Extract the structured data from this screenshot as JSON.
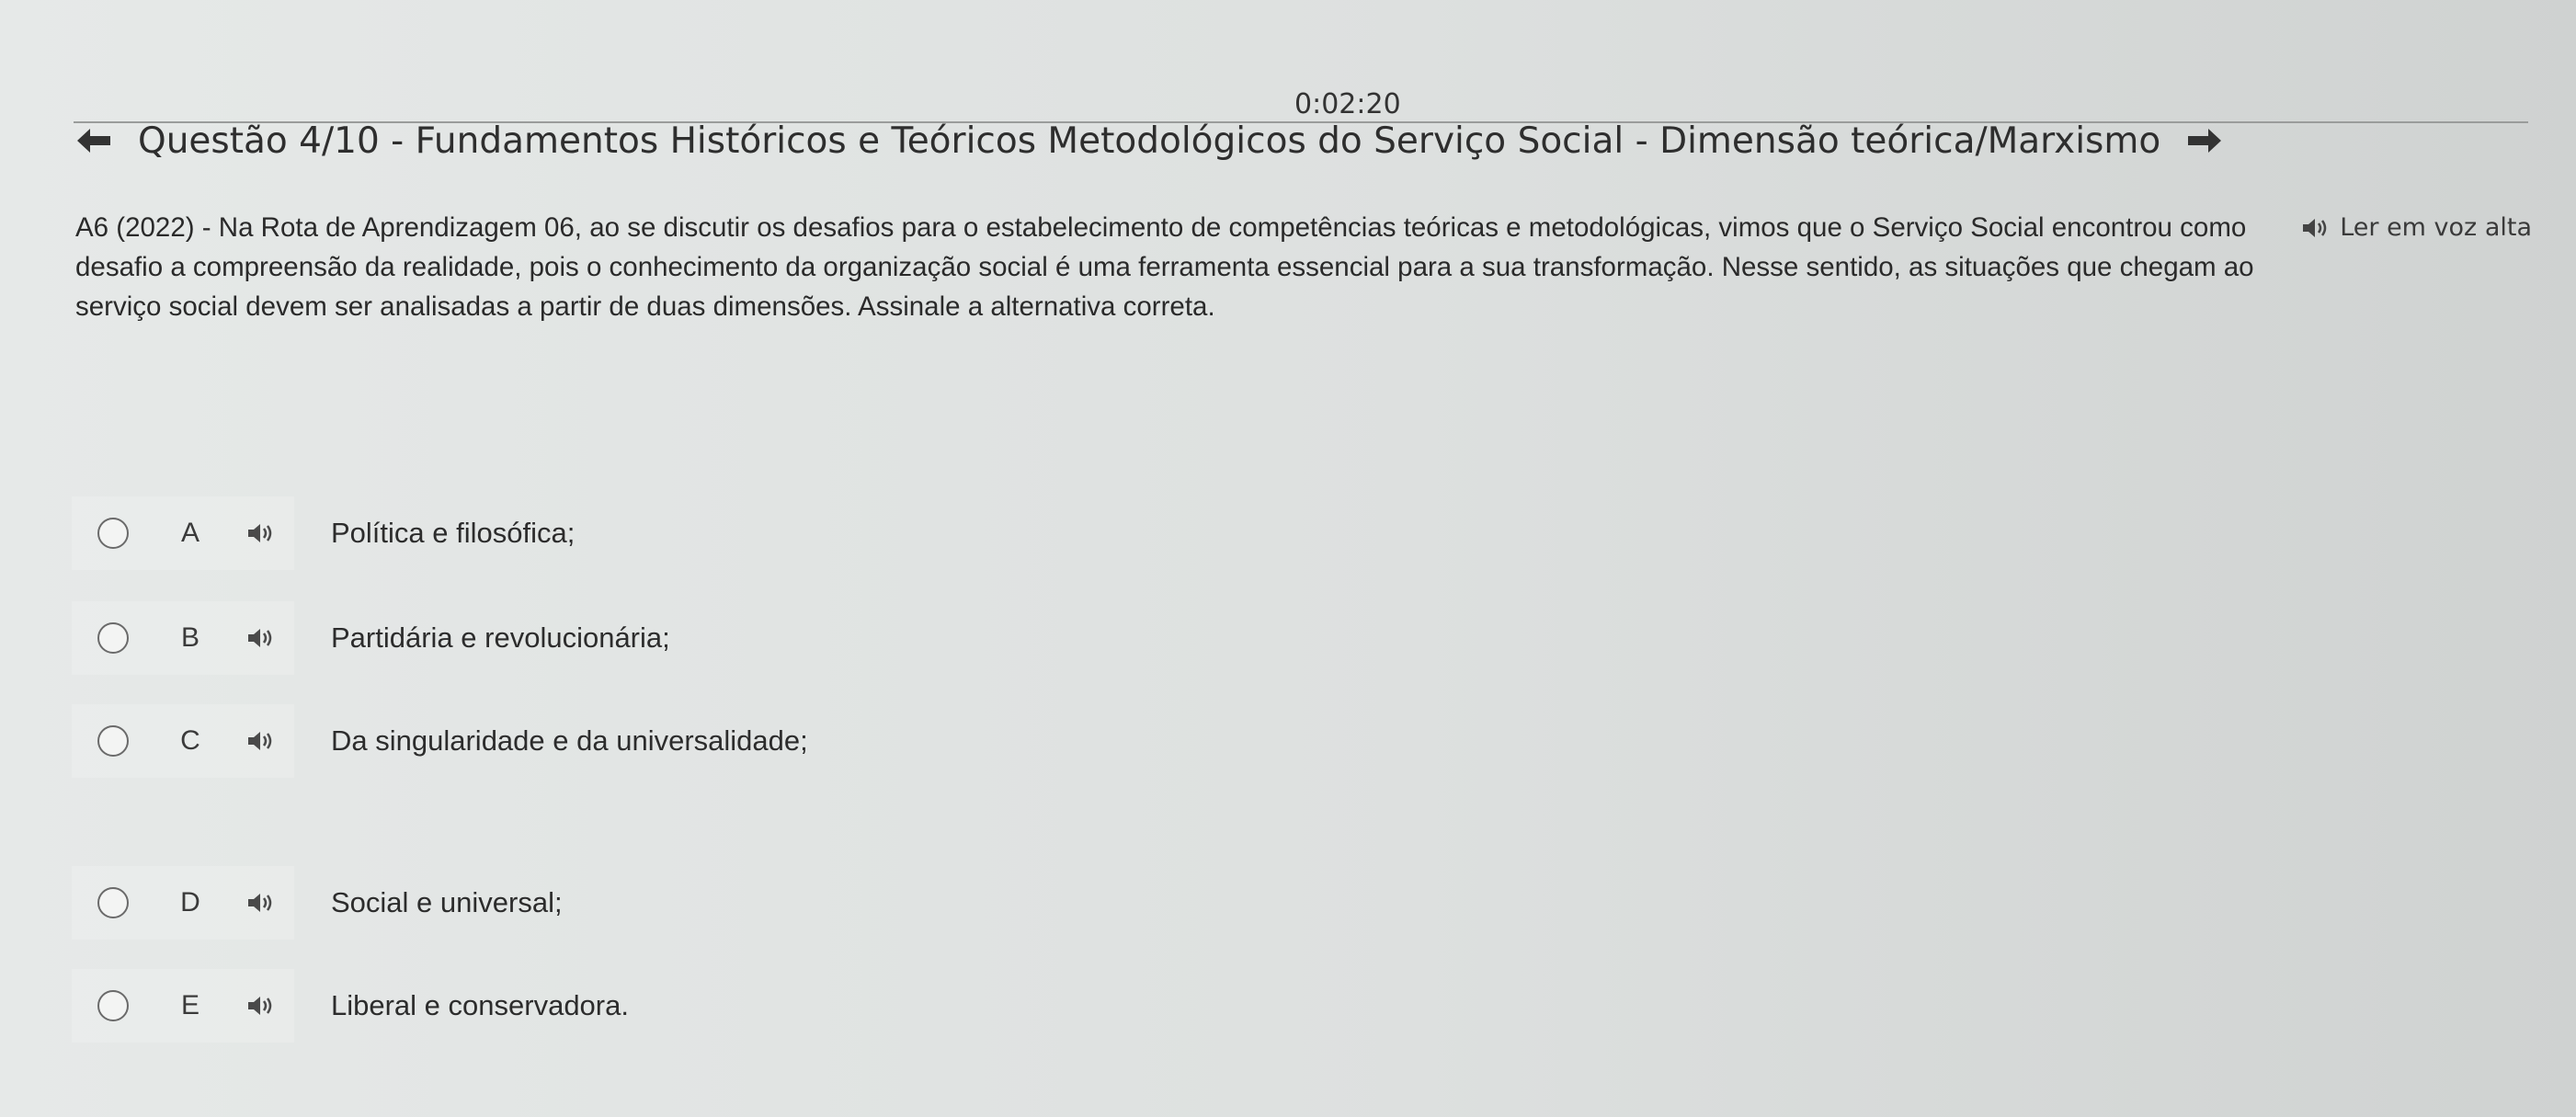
{
  "timer": "0:02:20",
  "header": {
    "title": "Questão 4/10 - Fundamentos Históricos e Teóricos Metodológicos do Serviço Social - Dimensão teórica/Marxismo",
    "prev_icon": "arrow-left-icon",
    "next_icon": "arrow-right-icon"
  },
  "tts": {
    "label": "Ler em voz alta",
    "icon": "speaker-icon"
  },
  "question": {
    "line1": "A6 (2022) - Na Rota de Aprendizagem 06, ao se discutir os desafios para o estabelecimento de competências teóricas e metodológicas, vimos que o Serviço Social encontrou como",
    "line2": "desafio a compreensão da realidade, pois o conhecimento da organização social é uma ferramenta essencial para a sua transformação. Nesse sentido, as situações que chegam ao",
    "line3": "serviço social devem ser analisadas a partir de duas dimensões. Assinale a alternativa correta."
  },
  "options": [
    {
      "letter": "A",
      "text": "Política e filosófica;"
    },
    {
      "letter": "B",
      "text": "Partidária e revolucionária;"
    },
    {
      "letter": "C",
      "text": "Da singularidade e da universalidade;"
    },
    {
      "letter": "D",
      "text": "Social e universal;"
    },
    {
      "letter": "E",
      "text": "Liberal e conservadora."
    }
  ]
}
